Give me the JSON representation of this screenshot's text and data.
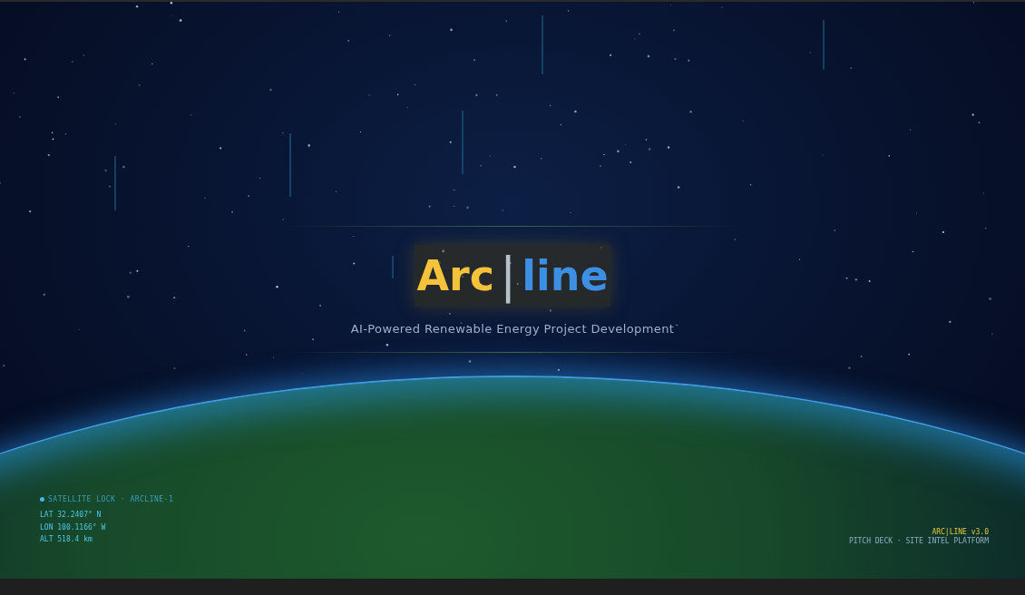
{
  "logo": {
    "left": "Arc",
    "separator": "|",
    "right": "line"
  },
  "tagline": "AI-Powered Renewable Energy Project Development",
  "satellite": {
    "status": "SATELLITE LOCK · ARCLINE-1",
    "locked": true,
    "readings": [
      "LAT 32.2407° N",
      "LON 100.1166° W",
      "ALT 518.4 km"
    ]
  },
  "version": {
    "title": "ARC|LINE v3.0",
    "subtitle": "PITCH DECK · SITE INTEL PLATFORM"
  }
}
